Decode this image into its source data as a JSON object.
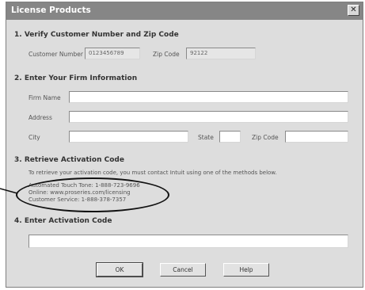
{
  "window": {
    "title": "License Products",
    "close_glyph": "✕"
  },
  "section1": {
    "heading": "1. Verify Customer Number and Zip Code",
    "customer_number_label": "Customer Number",
    "customer_number_value": "0123456789",
    "zip_label": "Zip Code",
    "zip_value": "92122"
  },
  "section2": {
    "heading": "2. Enter Your Firm Information",
    "firm_name_label": "Firm Name",
    "address_label": "Address",
    "city_label": "City",
    "state_label": "State",
    "zip_label": "Zip Code",
    "firm_name_value": "",
    "address_value": "",
    "city_value": "",
    "state_value": "",
    "zip_value": ""
  },
  "section3": {
    "heading": "3. Retrieve Activation Code",
    "instructions": "To retrieve your activation code, you must contact Intuit using one of the methods below.",
    "methods": [
      "Automated Touch Tone: 1-888-723-9696",
      "Online: www.proseries.com/licensing",
      "Customer Service: 1-888-378-7357"
    ]
  },
  "section4": {
    "heading": "4. Enter Activation Code",
    "activation_code_value": ""
  },
  "buttons": {
    "ok": "OK",
    "cancel": "Cancel",
    "help": "Help"
  }
}
